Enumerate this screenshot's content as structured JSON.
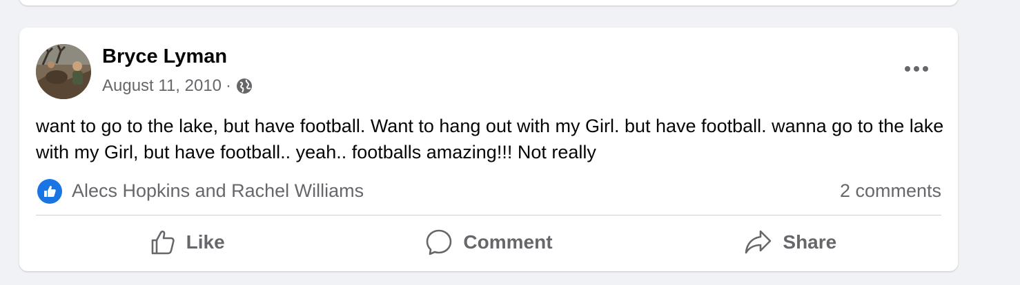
{
  "post": {
    "author": "Bryce Lyman",
    "date": "August 11, 2010",
    "separator": "·",
    "audience_icon": "globe-icon",
    "more_icon": "more-options-icon",
    "text": "want to go to the lake, but have football. Want to hang out with my Girl. but have football. wanna go to the lake with my Girl, but have football.. yeah.. footballs amazing!!! Not really",
    "reactions": {
      "icon": "like-reaction-icon",
      "names": "Alecs Hopkins and Rachel Williams",
      "comments": "2 comments"
    },
    "actions": [
      {
        "label": "Like",
        "icon": "thumbs-up-icon"
      },
      {
        "label": "Comment",
        "icon": "comment-icon"
      },
      {
        "label": "Share",
        "icon": "share-icon"
      }
    ]
  },
  "colors": {
    "background": "#f0f2f5",
    "card": "#ffffff",
    "primary_text": "#050505",
    "secondary_text": "#65676b",
    "like_blue": "#1b74e4",
    "divider": "#ced0d4"
  }
}
